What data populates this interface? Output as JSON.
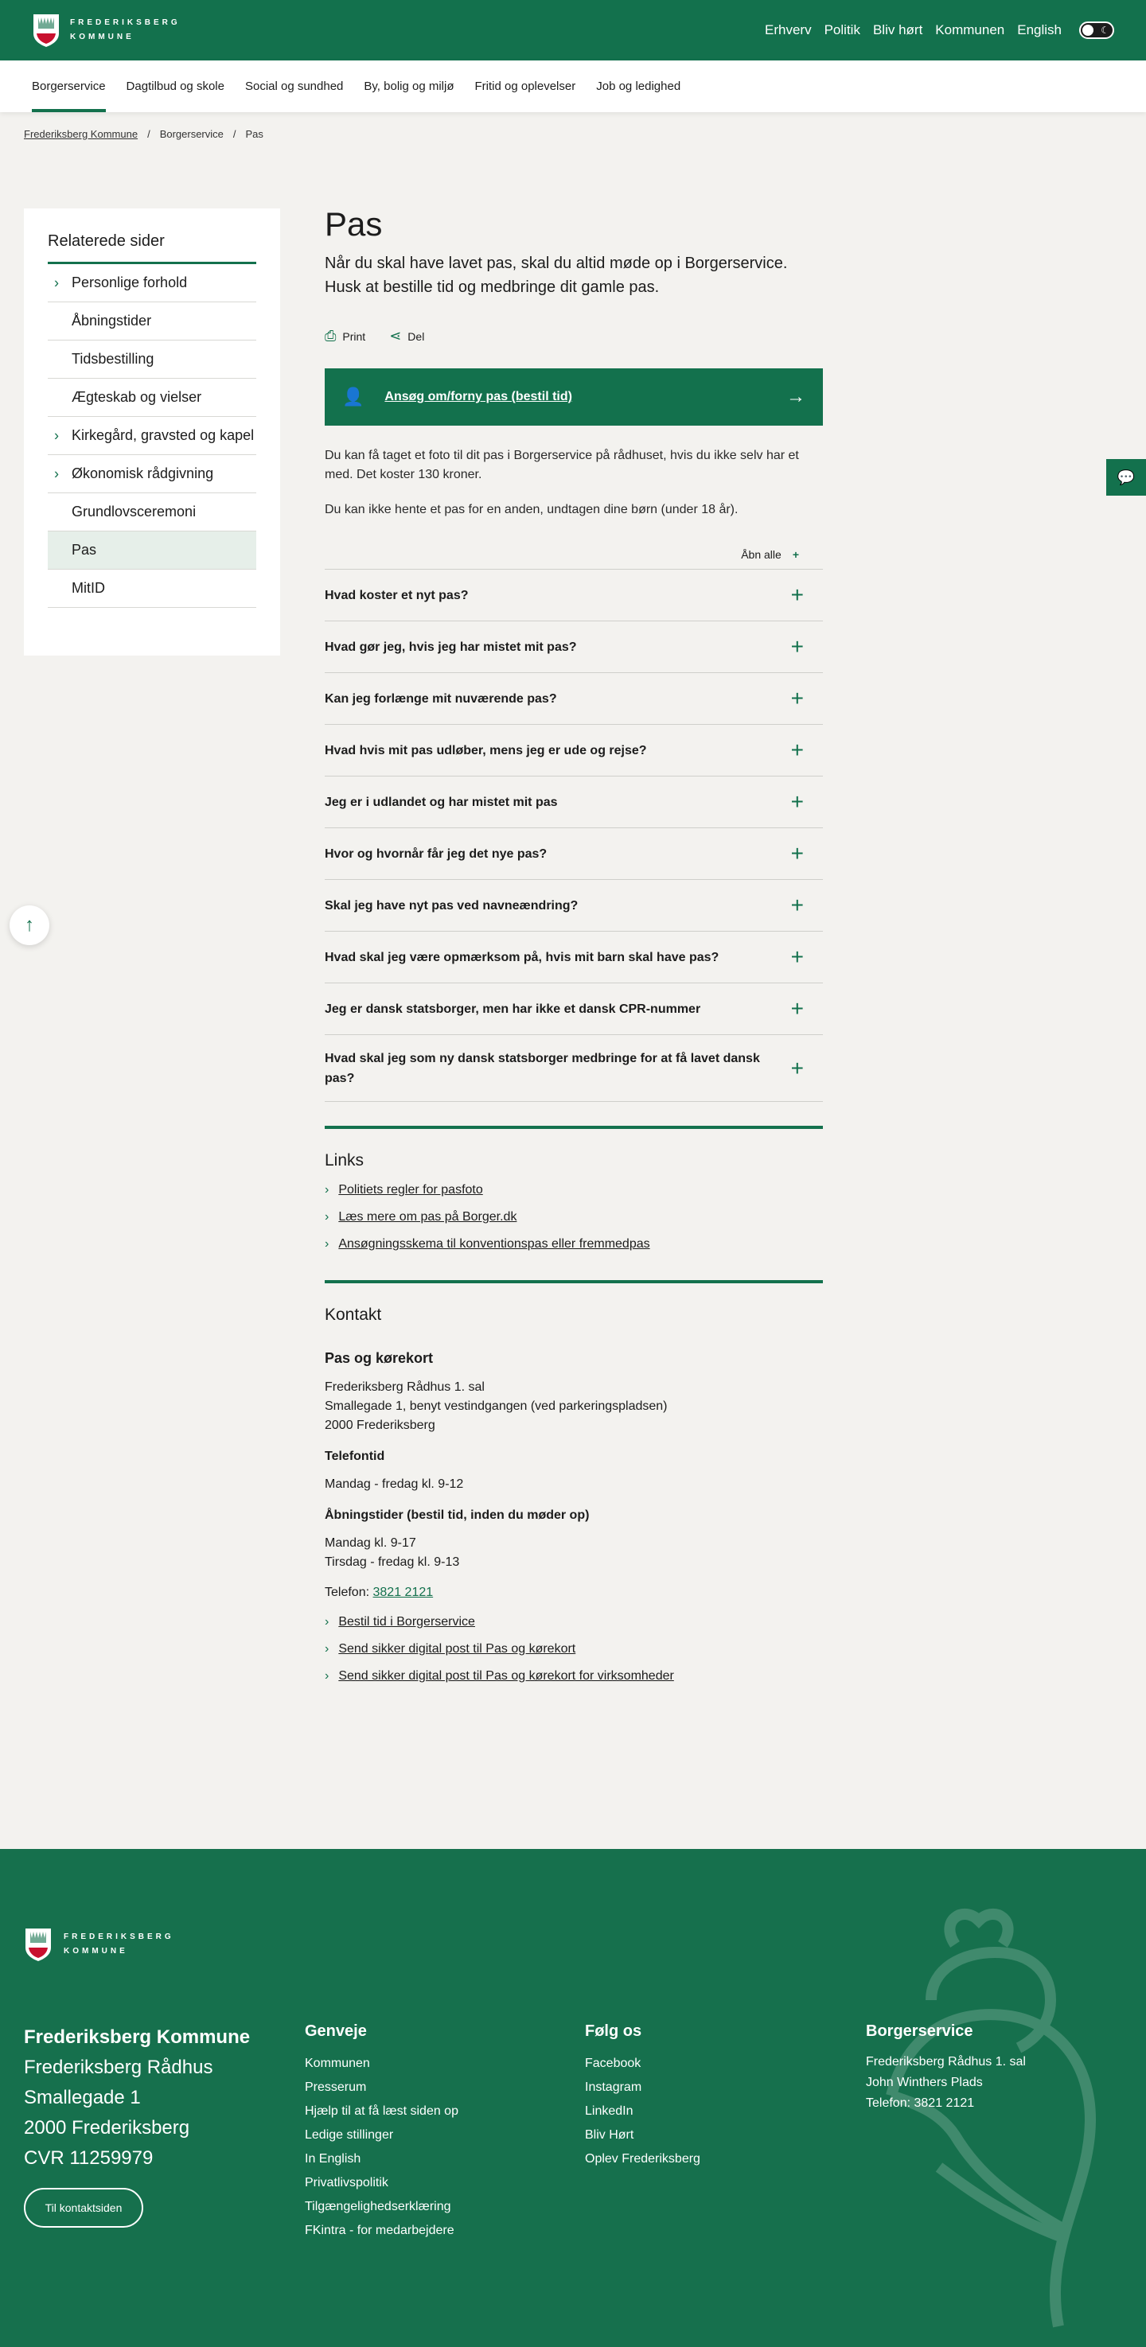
{
  "brand": {
    "line1": "FREDERIKSBERG",
    "line2": "KOMMUNE"
  },
  "top_nav": [
    "Erhverv",
    "Politik",
    "Bliv hørt",
    "Kommunen",
    "English"
  ],
  "main_nav": [
    "Borgerservice",
    "Dagtilbud og skole",
    "Social og sundhed",
    "By, bolig og miljø",
    "Fritid og oplevelser",
    "Job og ledighed"
  ],
  "breadcrumbs": [
    "Frederiksberg Kommune",
    "Borgerservice",
    "Pas"
  ],
  "sidebar": {
    "title": "Relaterede sider",
    "items": [
      {
        "label": "Personlige forhold",
        "chevron": true
      },
      {
        "label": "Åbningstider"
      },
      {
        "label": "Tidsbestilling"
      },
      {
        "label": "Ægteskab og vielser"
      },
      {
        "label": "Kirkegård, gravsted og kapel",
        "chevron": true
      },
      {
        "label": "Økonomisk rådgivning",
        "chevron": true
      },
      {
        "label": "Grundlovsceremoni"
      },
      {
        "label": "Pas",
        "current": true
      },
      {
        "label": "MitID"
      }
    ]
  },
  "page": {
    "title": "Pas",
    "intro": "Når du skal have lavet pas, skal du altid møde op i Borgerservice. Husk at bestille tid og medbringe dit gamle pas.",
    "print": "Print",
    "share": "Del",
    "cta": "Ansøg om/forny pas (bestil tid)",
    "para1": "Du kan få taget et foto til dit pas i Borgerservice på rådhuset, hvis du ikke selv har et med. Det koster 130 kroner.",
    "para2": "Du kan ikke hente et pas for en anden, undtagen dine børn (under 18 år).",
    "open_all": "Åbn alle",
    "faqs": [
      "Hvad koster et nyt pas?",
      "Hvad gør jeg, hvis jeg har mistet mit pas?",
      "Kan jeg forlænge mit nuværende pas?",
      "Hvad hvis mit pas udløber, mens jeg er ude og rejse?",
      "Jeg er i udlandet og har mistet mit pas",
      "Hvor og hvornår får jeg det nye pas?",
      "Skal jeg have nyt pas ved navneændring?",
      "Hvad skal jeg være opmærksom på, hvis mit barn skal have pas?",
      "Jeg er dansk statsborger, men har ikke et dansk CPR-nummer",
      "Hvad skal jeg som ny dansk statsborger medbringe for at få lavet dansk pas?"
    ]
  },
  "links": {
    "title": "Links",
    "items": [
      "Politiets regler for pasfoto",
      "Læs mere om pas på Borger.dk",
      "Ansøgningsskema til konventionspas eller fremmedpas"
    ]
  },
  "contact": {
    "title": "Kontakt",
    "subtitle": "Pas og kørekort",
    "address": [
      "Frederiksberg Rådhus 1. sal",
      "Smallegade 1, benyt vestindgangen (ved parkeringspladsen)",
      "2000 Frederiksberg"
    ],
    "phone_heading": "Telefontid",
    "phone_hours": "Mandag - fredag kl. 9-12",
    "open_heading": "Åbningstider (bestil tid, inden du møder op)",
    "open_hours": [
      "Mandag kl. 9-17",
      "Tirsdag - fredag kl. 9-13"
    ],
    "phone_label": "Telefon:",
    "phone": "3821 2121",
    "links": [
      "Bestil tid i Borgerservice",
      "Send sikker digital post til Pas og kørekort",
      "Send sikker digital post til Pas og kørekort for virksomheder"
    ]
  },
  "footer": {
    "col1": [
      "Frederiksberg Kommune",
      "Frederiksberg Rådhus",
      "Smallegade 1",
      "2000 Frederiksberg",
      "CVR 11259979"
    ],
    "contact_button": "Til kontaktsiden",
    "genveje_title": "Genveje",
    "genveje": [
      "Kommunen",
      "Presserum",
      "Hjælp til at få læst siden op",
      "Ledige stillinger",
      "In English",
      "Privatlivspolitik",
      "Tilgængelighedserklæring",
      "FKintra - for medarbejdere"
    ],
    "follow_title": "Følg os",
    "follow": [
      "Facebook",
      "Instagram",
      "LinkedIn",
      "Bliv Hørt",
      "Oplev Frederiksberg"
    ],
    "bs_title": "Borgerservice",
    "bs_lines": [
      "Frederiksberg Rådhus 1. sal",
      "John Winthers Plads"
    ],
    "bs_phone_label": "Telefon:",
    "bs_phone": "3821 2121"
  },
  "colors": {
    "brand_green": "#13714d",
    "background": "#f3f2ef",
    "current_item": "#e6efe9"
  }
}
